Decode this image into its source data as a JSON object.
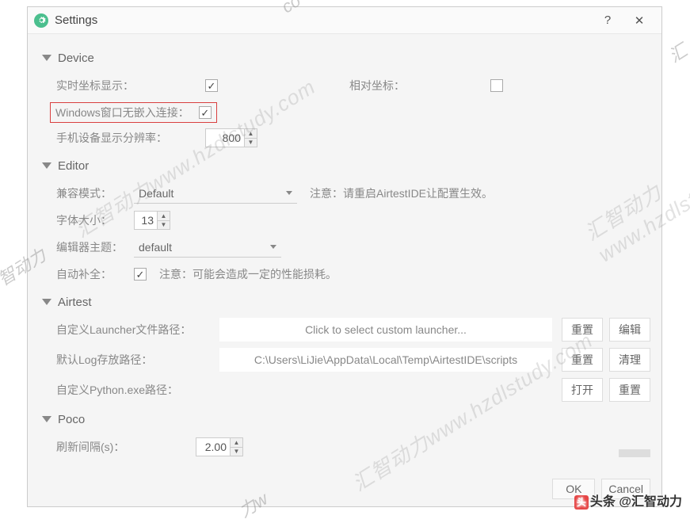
{
  "window": {
    "title": "Settings",
    "help": "?",
    "close": "✕"
  },
  "sections": {
    "device": {
      "title": "Device",
      "realtime_coord_label": "实时坐标显示：",
      "relative_coord_label": "相对坐标：",
      "windows_embed_label": "Windows窗口无嵌入连接：",
      "resolution_label": "手机设备显示分辨率：",
      "resolution_value": "800"
    },
    "editor": {
      "title": "Editor",
      "compat_label": "兼容模式：",
      "compat_value": "Default",
      "compat_note": "注意：请重启AirtestIDE让配置生效。",
      "font_label": "字体大小：",
      "font_value": "13",
      "theme_label": "编辑器主题：",
      "theme_value": "default",
      "autocomplete_label": "自动补全：",
      "autocomplete_note": "注意：可能会造成一定的性能损耗。"
    },
    "airtest": {
      "title": "Airtest",
      "launcher_label": "自定义Launcher文件路径：",
      "launcher_placeholder": "Click to select custom launcher...",
      "log_label": "默认Log存放路径：",
      "log_value": "C:\\Users\\LiJie\\AppData\\Local\\Temp\\AirtestIDE\\scripts",
      "python_label": "自定义Python.exe路径：",
      "btn_reset": "重置",
      "btn_edit": "编辑",
      "btn_clean": "清理",
      "btn_open": "打开"
    },
    "poco": {
      "title": "Poco",
      "refresh_label": "刷新间隔(s)：",
      "refresh_value": "2.00"
    }
  },
  "footer": {
    "ok": "OK",
    "cancel": "Cancel"
  },
  "watermark": "汇智动力www.hzdlstudy.com",
  "credit_prefix": "头条 @",
  "credit_name": "汇智动力"
}
